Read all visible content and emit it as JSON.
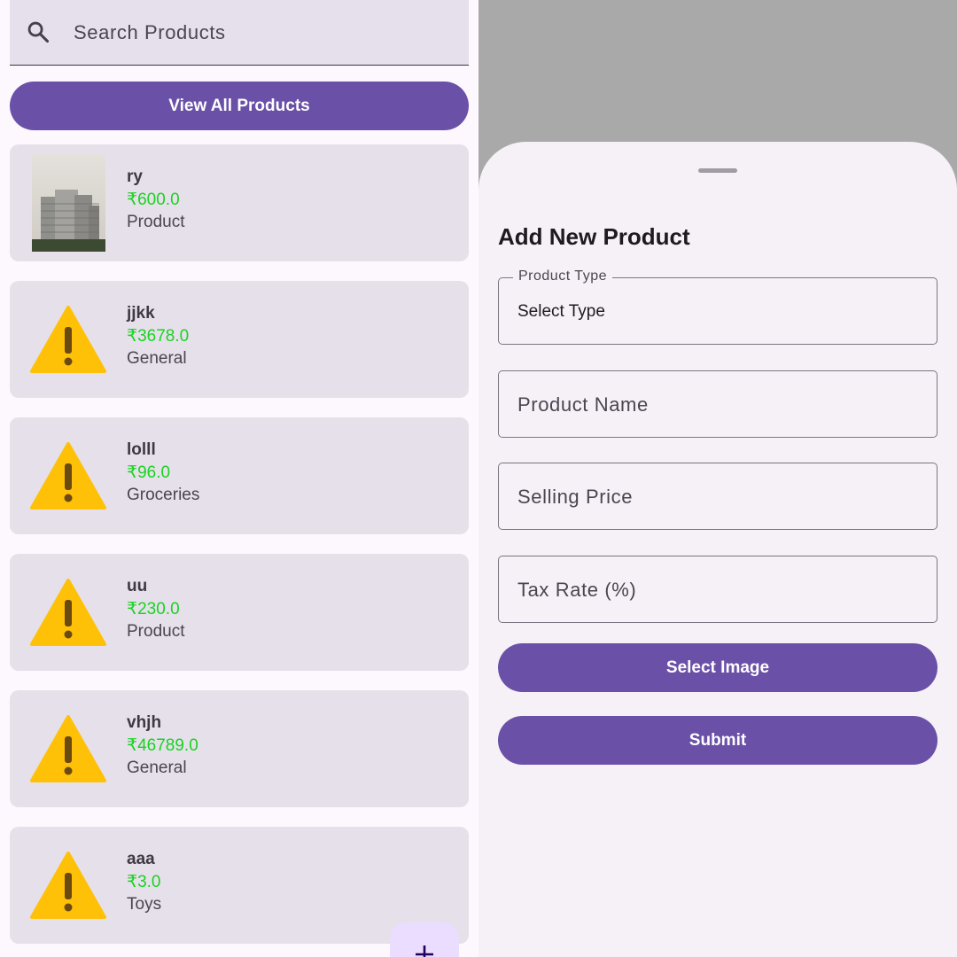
{
  "search": {
    "placeholder": "Search Products",
    "icon": "search-icon"
  },
  "view_all_label": "View All Products",
  "products": [
    {
      "name": "ry",
      "price": "₹600.0",
      "type": "Product",
      "image": "building-photo"
    },
    {
      "name": "jjkk",
      "price": "₹3678.0",
      "type": "General",
      "image": "warning-icon"
    },
    {
      "name": "lolll",
      "price": "₹96.0",
      "type": "Groceries",
      "image": "warning-icon"
    },
    {
      "name": "uu",
      "price": "₹230.0",
      "type": "Product",
      "image": "warning-icon"
    },
    {
      "name": "vhjh",
      "price": "₹46789.0",
      "type": "General",
      "image": "warning-icon"
    },
    {
      "name": "aaa",
      "price": "₹3.0",
      "type": "Toys",
      "image": "warning-icon"
    }
  ],
  "fab": {
    "icon": "plus-icon"
  },
  "sheet": {
    "title": "Add New Product",
    "product_type": {
      "label": "Product Type",
      "value": "Select Type"
    },
    "product_name_placeholder": "Product Name",
    "selling_price_placeholder": "Selling Price",
    "tax_rate_placeholder": "Tax Rate (%)",
    "select_image_label": "Select Image",
    "submit_label": "Submit"
  },
  "colors": {
    "primary": "#6a50a7",
    "price_green": "#19d321",
    "card_bg": "#e6e0ea",
    "warning_yellow": "#ffc107",
    "scrim": "#a9a9a9"
  }
}
